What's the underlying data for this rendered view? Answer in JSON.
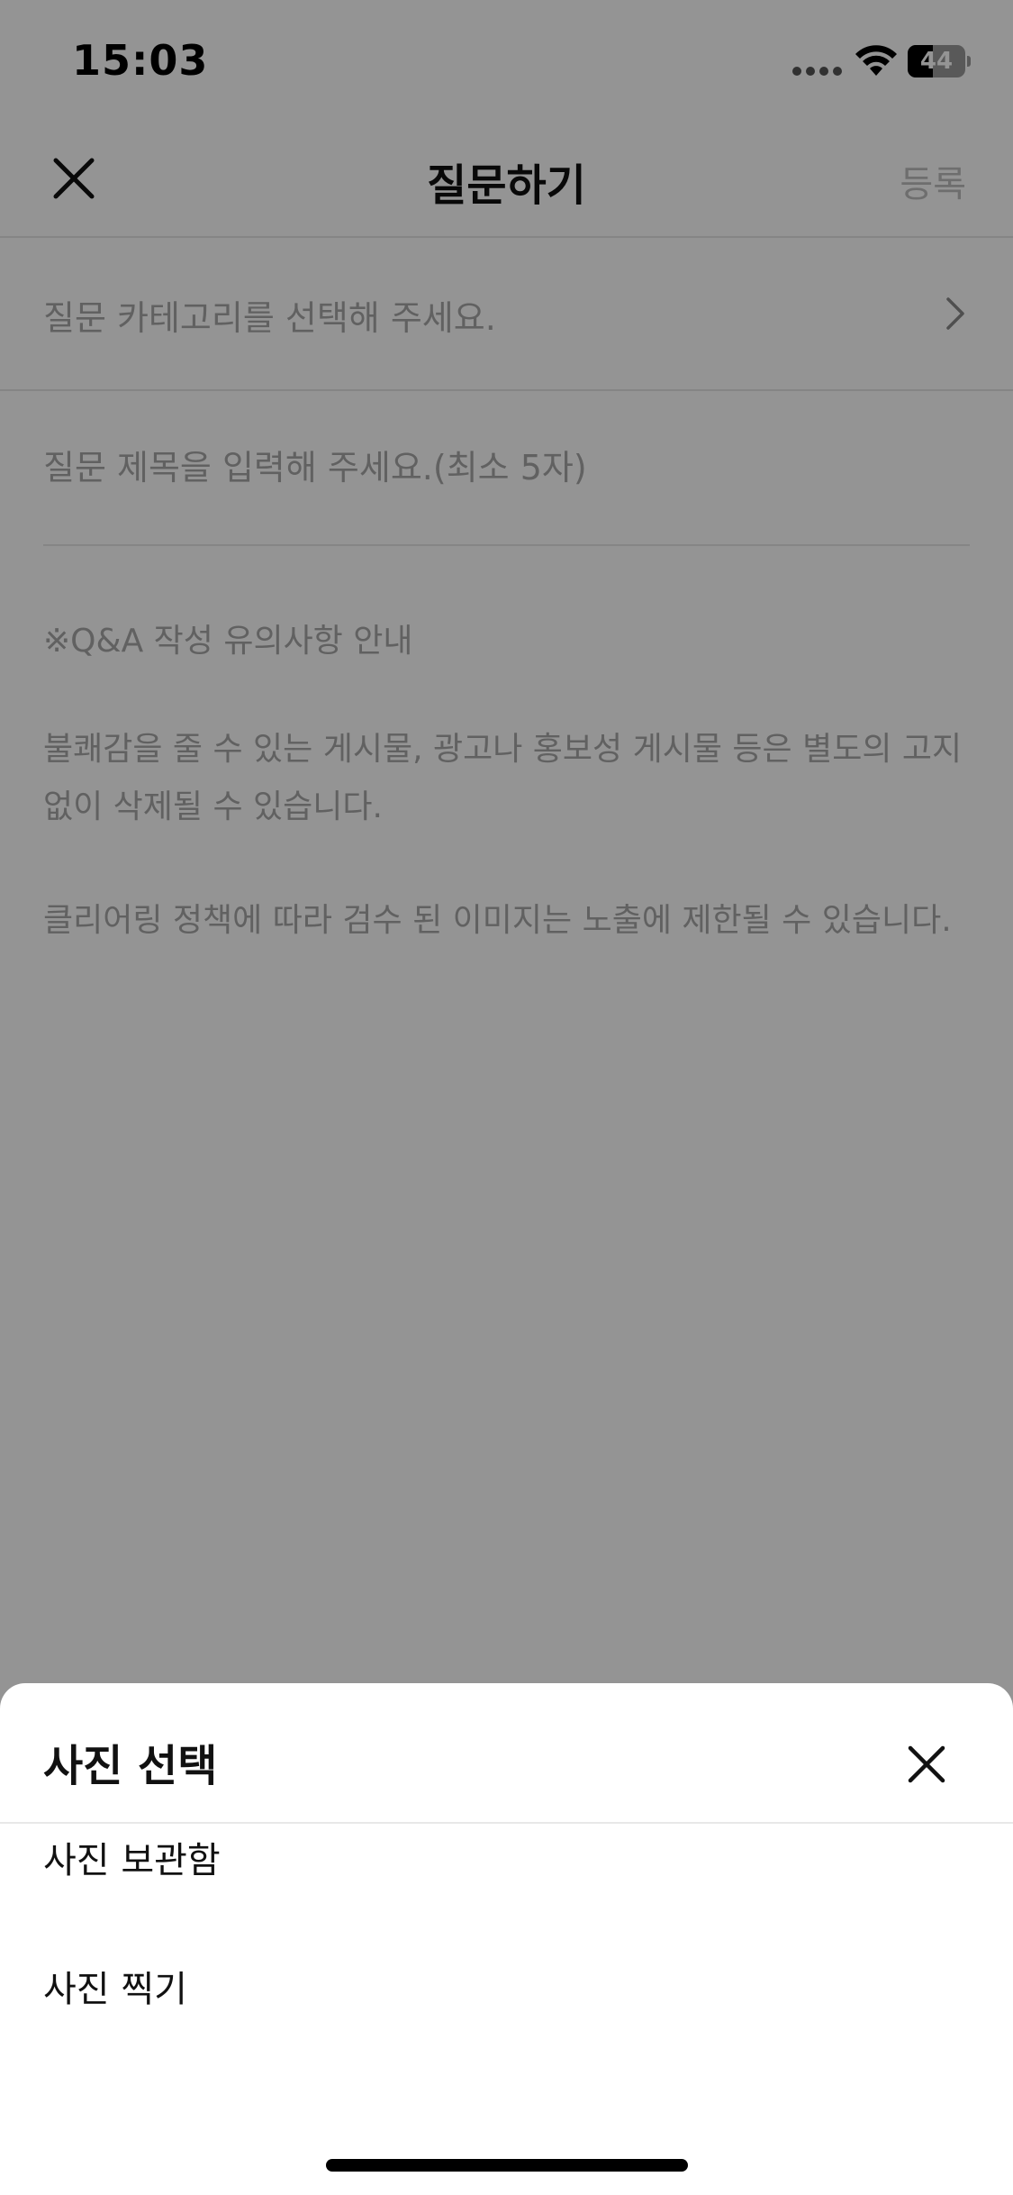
{
  "status_bar": {
    "time": "15:03",
    "battery_level": "44",
    "battery_fraction": 0.44
  },
  "nav": {
    "title": "질문하기",
    "submit_label": "등록",
    "close_icon": "close-icon"
  },
  "form": {
    "category_placeholder": "질문 카테고리를 선택해 주세요.",
    "title_placeholder": "질문 제목을 입력해 주세요.(최소 5자)",
    "title_value": ""
  },
  "notice": {
    "heading": "※Q&A 작성 유의사항 안내",
    "paragraph_1": "불쾌감을 줄 수 있는 게시물, 광고나 홍보성 게시물 등은 별도의 고지 없이 삭제될 수 있습니다.",
    "paragraph_2": "클리어링 정책에 따라 검수 된 이미지는 노출에 제한될 수 있습니다."
  },
  "sheet": {
    "title": "사진 선택",
    "options": [
      {
        "label": "사진 보관함"
      },
      {
        "label": "사진 찍기"
      }
    ]
  },
  "colors": {
    "overlay": "rgba(0,0,0,0.42)",
    "placeholder_text": "#a8a8a8",
    "submit_disabled": "#bdbdbd",
    "divider": "#e5e5e5"
  }
}
